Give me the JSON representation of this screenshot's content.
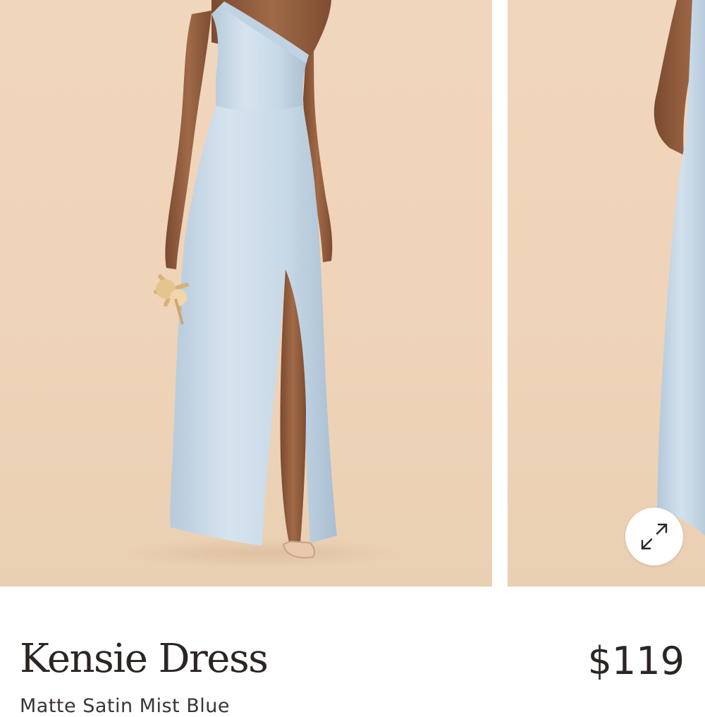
{
  "gallery": {
    "images": [
      {
        "alt": "Model wearing one-shoulder light blue satin dress holding dried flowers"
      },
      {
        "alt": "Side view of model wearing light blue satin dress"
      }
    ],
    "expand_icon": "expand-arrows-icon"
  },
  "product": {
    "title": "Kensie Dress",
    "price": "$119",
    "color": "Matte Satin Mist Blue"
  },
  "colors": {
    "background": "#f0d6bd",
    "dress": "#c9dbe9",
    "text": "#2b2624"
  }
}
